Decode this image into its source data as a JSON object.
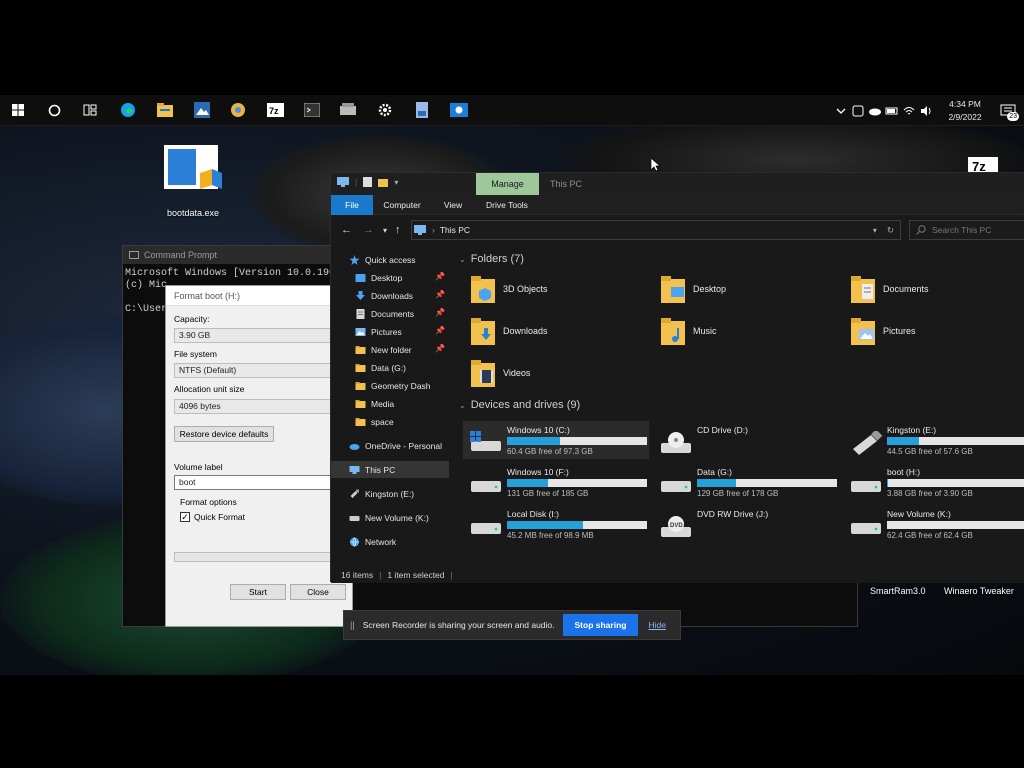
{
  "taskbar": {
    "clock_time": "4:34 PM",
    "clock_date": "2/9/2022",
    "notification_count": "23"
  },
  "desktop": {
    "icons": [
      {
        "label": "bootdata.exe"
      },
      {
        "label": "7z"
      },
      {
        "label": "SmartRam3.0"
      },
      {
        "label": "Winaero Tweaker"
      }
    ]
  },
  "cmd": {
    "title": "Command Prompt",
    "line1": "Microsoft Windows [Version 10.0.190",
    "line2": "(c) Mic",
    "line3": "C:\\User"
  },
  "format_dialog": {
    "title": "Format boot (H:)",
    "capacity_label": "Capacity:",
    "capacity_value": "3.90 GB",
    "filesystem_label": "File system",
    "filesystem_value": "NTFS (Default)",
    "alloc_label": "Allocation unit size",
    "alloc_value": "4096 bytes",
    "restore_label": "Restore device defaults",
    "volume_label": "Volume label",
    "volume_value": "boot",
    "format_options_label": "Format options",
    "quick_format_label": "Quick Format",
    "quick_format_checked": true,
    "start_label": "Start",
    "close_label": "Close"
  },
  "explorer": {
    "manage_tab": "Manage",
    "window_title": "This PC",
    "ribbon_tabs": [
      "File",
      "Computer",
      "View",
      "Drive Tools"
    ],
    "address": "This PC",
    "search_placeholder": "Search This PC",
    "nav": [
      {
        "label": "Quick access",
        "pinned": false
      },
      {
        "label": "Desktop",
        "pinned": true
      },
      {
        "label": "Downloads",
        "pinned": true
      },
      {
        "label": "Documents",
        "pinned": true
      },
      {
        "label": "Pictures",
        "pinned": true
      },
      {
        "label": "New folder",
        "pinned": true
      },
      {
        "label": "Data (G:)",
        "pinned": false
      },
      {
        "label": "Geometry Dash",
        "pinned": false
      },
      {
        "label": "Media",
        "pinned": false
      },
      {
        "label": "space",
        "pinned": false
      },
      {
        "label": "OneDrive - Personal",
        "pinned": false
      },
      {
        "label": "This PC",
        "pinned": false
      },
      {
        "label": "Kingston (E:)",
        "pinned": false
      },
      {
        "label": "New Volume (K:)",
        "pinned": false
      },
      {
        "label": "Network",
        "pinned": false
      }
    ],
    "folders_heading": "Folders (7)",
    "folders": [
      "3D Objects",
      "Desktop",
      "Documents",
      "Downloads",
      "Music",
      "Pictures",
      "Videos"
    ],
    "drives_heading": "Devices and drives (9)",
    "drives": [
      {
        "name": "Windows 10 (C:)",
        "free": "60.4 GB free of 97.3 GB",
        "used_fraction": 0.38,
        "has_bar": true
      },
      {
        "name": "CD Drive (D:)",
        "free": "",
        "used_fraction": 0,
        "has_bar": false
      },
      {
        "name": "Kingston (E:)",
        "free": "44.5 GB free of 57.6 GB",
        "used_fraction": 0.23,
        "has_bar": true
      },
      {
        "name": "Windows 10 (F:)",
        "free": "131 GB free of 185 GB",
        "used_fraction": 0.29,
        "has_bar": true
      },
      {
        "name": "Data (G:)",
        "free": "129 GB free of 178 GB",
        "used_fraction": 0.28,
        "has_bar": true
      },
      {
        "name": "boot (H:)",
        "free": "3.88 GB free of 3.90 GB",
        "used_fraction": 0.01,
        "has_bar": true
      },
      {
        "name": "Local Disk (I:)",
        "free": "45.2 MB free of 98.9 MB",
        "used_fraction": 0.54,
        "has_bar": true
      },
      {
        "name": "DVD RW Drive (J:)",
        "free": "",
        "used_fraction": 0,
        "has_bar": false
      },
      {
        "name": "New Volume (K:)",
        "free": "62.4 GB free of 62.4 GB",
        "used_fraction": 0.0,
        "has_bar": true
      }
    ],
    "status_items": "16 items",
    "status_selected": "1 item selected"
  },
  "share_bar": {
    "pause_icon": "||",
    "message": "Screen Recorder is sharing your screen and audio.",
    "stop_label": "Stop sharing",
    "hide_label": "Hide"
  },
  "colors": {
    "accent": "#1979ca",
    "manage_tab": "#9ec79a",
    "drive_fill": "#26a0da",
    "stop_button": "#1a73e8"
  }
}
